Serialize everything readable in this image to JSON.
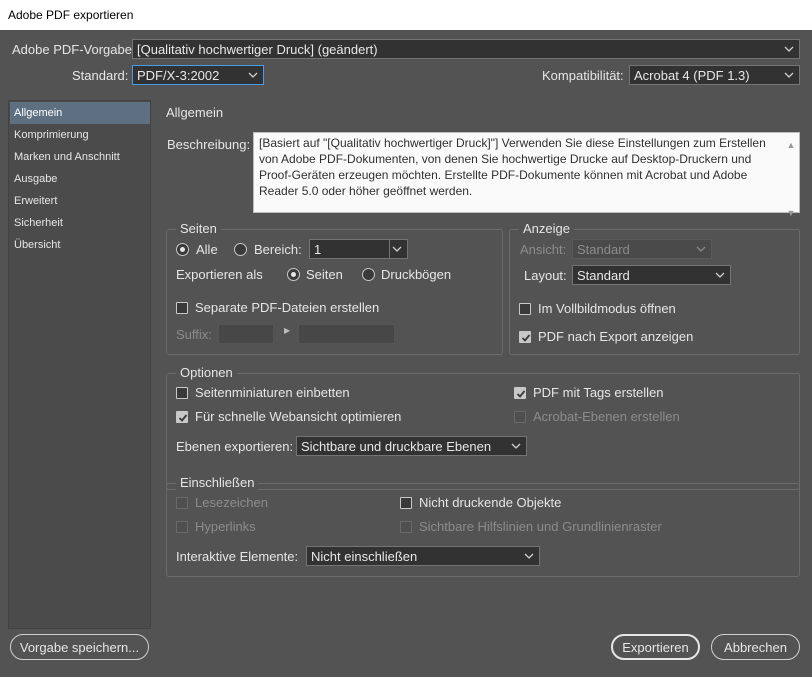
{
  "window": {
    "title": "Adobe PDF exportieren"
  },
  "preset": {
    "label": "Adobe PDF-Vorgabe:",
    "value": "[Qualitativ hochwertiger Druck] (geändert)"
  },
  "standard": {
    "label": "Standard:",
    "value": "PDF/X-3:2002"
  },
  "compat": {
    "label": "Kompatibilität:",
    "value": "Acrobat 4 (PDF 1.3)"
  },
  "sidebar": {
    "items": [
      {
        "label": "Allgemein"
      },
      {
        "label": "Komprimierung"
      },
      {
        "label": "Marken und Anschnitt"
      },
      {
        "label": "Ausgabe"
      },
      {
        "label": "Erweitert"
      },
      {
        "label": "Sicherheit"
      },
      {
        "label": "Übersicht"
      }
    ]
  },
  "main": {
    "section_title": "Allgemein",
    "description_label": "Beschreibung:",
    "description": "[Basiert auf \"[Qualitativ hochwertiger Druck]\"] Verwenden Sie diese Einstellungen zum Erstellen von Adobe PDF-Dokumenten, von denen Sie hochwertige Drucke auf Desktop-Druckern und Proof-Geräten erzeugen möchten. Erstellte PDF-Dokumente können mit Acrobat und Adobe Reader 5.0 oder höher geöffnet werden."
  },
  "pages": {
    "title": "Seiten",
    "all_label": "Alle",
    "range_label": "Bereich:",
    "range_value": "1",
    "export_as_label": "Exportieren als",
    "pages_option": "Seiten",
    "spreads_option": "Druckbögen",
    "separate_label": "Separate PDF-Dateien erstellen",
    "suffix_label": "Suffix:"
  },
  "view": {
    "title": "Anzeige",
    "view_label": "Ansicht:",
    "view_value": "Standard",
    "layout_label": "Layout:",
    "layout_value": "Standard",
    "fullscreen_label": "Im Vollbildmodus öffnen",
    "after_export_label": "PDF nach Export anzeigen"
  },
  "options": {
    "title": "Optionen",
    "thumbnails_label": "Seitenminiaturen einbetten",
    "fastweb_label": "Für schnelle Webansicht optimieren",
    "tagged_label": "PDF mit Tags erstellen",
    "layers_label": "Acrobat-Ebenen erstellen",
    "export_layers_label": "Ebenen exportieren:",
    "export_layers_value": "Sichtbare und druckbare Ebenen"
  },
  "include": {
    "title": "Einschließen",
    "bookmarks_label": "Lesezeichen",
    "hyperlinks_label": "Hyperlinks",
    "nonprinting_label": "Nicht druckende Objekte",
    "guides_label": "Sichtbare Hilfslinien und Grundlinienraster",
    "interactive_label": "Interaktive Elemente:",
    "interactive_value": "Nicht einschließen"
  },
  "buttons": {
    "save_preset": "Vorgabe speichern...",
    "export": "Exportieren",
    "cancel": "Abbrechen"
  }
}
